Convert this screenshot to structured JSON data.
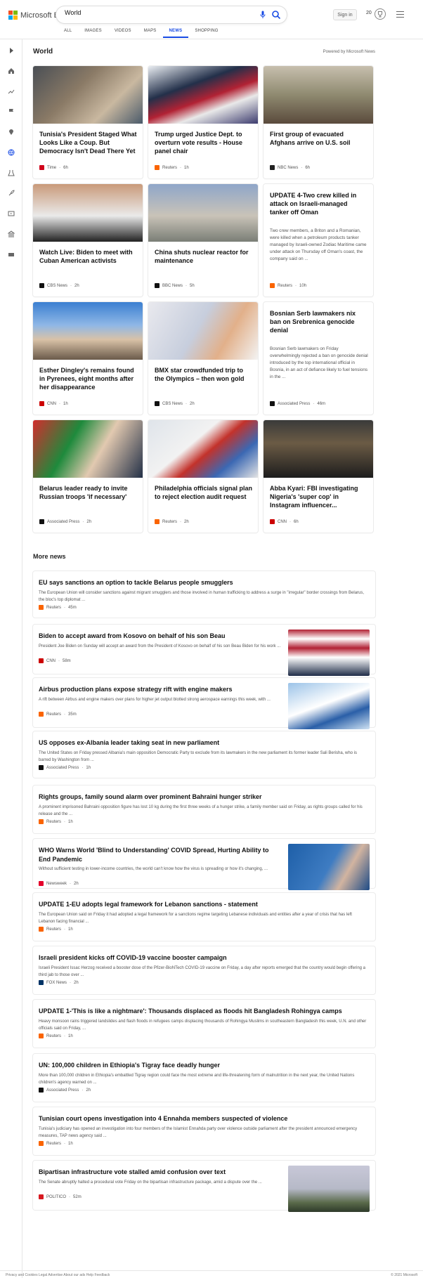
{
  "header": {
    "logo_text": "Microsoft Bing",
    "search_value": "World",
    "signin_label": "Sign in",
    "points": "20"
  },
  "tabs": [
    "ALL",
    "IMAGES",
    "VIDEOS",
    "MAPS",
    "NEWS",
    "SHOPPING"
  ],
  "active_tab": "NEWS",
  "section": {
    "title": "World",
    "powered": "Powered by Microsoft News"
  },
  "cards": [
    {
      "title": "Tunisia's President Staged What Looks Like a Coup. But Democracy Isn't Dead There Yet",
      "source": "Time",
      "time": "6h",
      "logo_color": "#d0021b"
    },
    {
      "title": "Trump urged Justice Dept. to overturn vote results - House panel chair",
      "source": "Reuters",
      "time": "1h",
      "logo_color": "#fa6400"
    },
    {
      "title": "First group of evacuated Afghans arrive on U.S. soil",
      "source": "NBC News",
      "time": "6h",
      "logo_color": "#222222"
    },
    {
      "title": "Watch Live: Biden to meet with Cuban American activists",
      "source": "CBS News",
      "time": "2h",
      "logo_color": "#111111"
    },
    {
      "title": "China shuts nuclear reactor for maintenance",
      "source": "BBC News",
      "time": "5h",
      "logo_color": "#111111"
    },
    {
      "title": "UPDATE 4-Two crew killed in attack on Israeli-managed tanker off Oman",
      "snippet": "Two crew members, a Briton and a Romanian, were killed when a petroleum products tanker managed by Israeli-owned Zodiac Maritime came under attack on Thursday off Oman's coast, the company said on ...",
      "source": "Reuters",
      "time": "10h",
      "logo_color": "#fa6400"
    },
    {
      "title": "Esther Dingley's remains found in Pyrenees, eight months after her disappearance",
      "source": "CNN",
      "time": "1h",
      "logo_color": "#cc0000"
    },
    {
      "title": "BMX star crowdfunded trip to the Olympics – then won gold",
      "source": "CBS News",
      "time": "2h",
      "logo_color": "#111111"
    },
    {
      "title": "Bosnian Serb lawmakers nix ban on Srebrenica genocide denial",
      "snippet": "Bosnian Serb lawmakers on Friday overwhelmingly rejected a ban on genocide denial introduced by the top international official in Bosnia, in an act of defiance likely to fuel tensions in the ...",
      "source": "Associated Press",
      "time": "46m",
      "logo_color": "#111111"
    },
    {
      "title": "Belarus leader ready to invite Russian troops 'if necessary'",
      "source": "Associated Press",
      "time": "2h",
      "logo_color": "#111111"
    },
    {
      "title": "Philadelphia officials signal plan to reject election audit request",
      "source": "Reuters",
      "time": "2h",
      "logo_color": "#fa6400"
    },
    {
      "title": "Abba Kyari: FBI investigating Nigeria's 'super cop' in Instagram influencer...",
      "source": "CNN",
      "time": "6h",
      "logo_color": "#cc0000"
    }
  ],
  "more_news_title": "More news",
  "more_news": [
    {
      "title": "EU says sanctions an option to tackle Belarus people smugglers",
      "snippet": "The European Union will consider sanctions against migrant smugglers and those involved in human trafficking to address a surge in \"irregular\" border crossings from Belarus, the bloc's top diplomat ...",
      "source": "Reuters",
      "time": "45m",
      "logo_color": "#fa6400"
    },
    {
      "title": "Biden to accept award from Kosovo on behalf of his son Beau",
      "snippet": "President Joe Biden on Sunday will accept an award from the President of Kosovo on behalf of his son Beau Biden for his work ...",
      "source": "CNN",
      "time": "58m",
      "logo_color": "#cc0000"
    },
    {
      "title": "Airbus production plans expose strategy rift with engine makers",
      "snippet": "A rift between Airbus and engine makers over plans for higher jet output blotted strong aerospace earnings this week, with ...",
      "source": "Reuters",
      "time": "35m",
      "logo_color": "#fa6400"
    },
    {
      "title": "US opposes ex-Albania leader taking seat in new parliament",
      "snippet": "The United States on Friday pressed Albania's main opposition Democratic Party to exclude from its lawmakers in the new parliament its former leader Sali Berisha, who is barred by Washington from ...",
      "source": "Associated Press",
      "time": "1h",
      "logo_color": "#111111"
    },
    {
      "title": "Rights groups, family sound alarm over prominent Bahraini hunger striker",
      "snippet": "A prominent imprisoned Bahraini opposition figure has lost 10 kg during the first three weeks of a hunger strike, a family member said on Friday, as rights groups called for his release and the ...",
      "source": "Reuters",
      "time": "1h",
      "logo_color": "#fa6400"
    },
    {
      "title": "WHO Warns World 'Blind to Understanding' COVID Spread, Hurting Ability to End Pandemic",
      "snippet": "Without sufficient testing in lower-income countries, the world can't know how the virus is spreading or how it's changing, ...",
      "source": "Newsweek",
      "time": "2h",
      "logo_color": "#e4002b"
    },
    {
      "title": "UPDATE 1-EU adopts legal framework for Lebanon sanctions - statement",
      "snippet": "The European Union said on Friday it had adopted a legal framework for a sanctions regime targeting Lebanese individuals and entities after a year of crisis that has left Lebanon facing financial ...",
      "source": "Reuters",
      "time": "1h",
      "logo_color": "#fa6400"
    },
    {
      "title": "Israeli president kicks off COVID-19 vaccine booster campaign",
      "snippet": "Israeli President Issac Herzog received a booster dose of the Pfizer-BioNTech COVID-19 vaccine on Friday, a day after reports emerged that the country would begin offering a third jab to those over ...",
      "source": "FOX News",
      "time": "2h",
      "logo_color": "#003366"
    },
    {
      "title": "UPDATE 1-'This is like a nightmare': Thousands displaced as floods hit Bangladesh Rohingya camps",
      "snippet": "Heavy monsoon rains triggered landslides and flash floods in refugees camps displacing thousands of Rohingya Muslims in southeastern Bangladesh this week, U.N. and other officials said on Friday, ...",
      "source": "Reuters",
      "time": "1h",
      "logo_color": "#fa6400"
    },
    {
      "title": "UN: 100,000 children in Ethiopia's Tigray face deadly hunger",
      "snippet": "More than 100,000 children in Ethiopia's embattled Tigray region could face the most extreme and life-threatening form of malnutrition in the next year, the United Nations children's agency warned on ...",
      "source": "Associated Press",
      "time": "2h",
      "logo_color": "#111111"
    },
    {
      "title": "Tunisian court opens investigation into 4 Ennahda members suspected of violence",
      "snippet": "Tunisia's judiciary has opened an investigation into four members of the Islamist Ennahda party over violence outside parliament after the president announced emergency measures, TAP news agency said ...",
      "source": "Reuters",
      "time": "1h",
      "logo_color": "#fa6400"
    },
    {
      "title": "Bipartisan infrastructure vote stalled amid confusion over text",
      "snippet": "The Senate abruptly halted a procedural vote Friday on the bipartisan infrastructure package, amid a dispute over the ...",
      "source": "POLITICO",
      "time": "52m",
      "logo_color": "#d71920"
    }
  ],
  "footer": {
    "text": "Privacy and Cookies   Legal   Advertise   About our ads   Help   Feedback",
    "copyright": "© 2021 Microsoft"
  }
}
